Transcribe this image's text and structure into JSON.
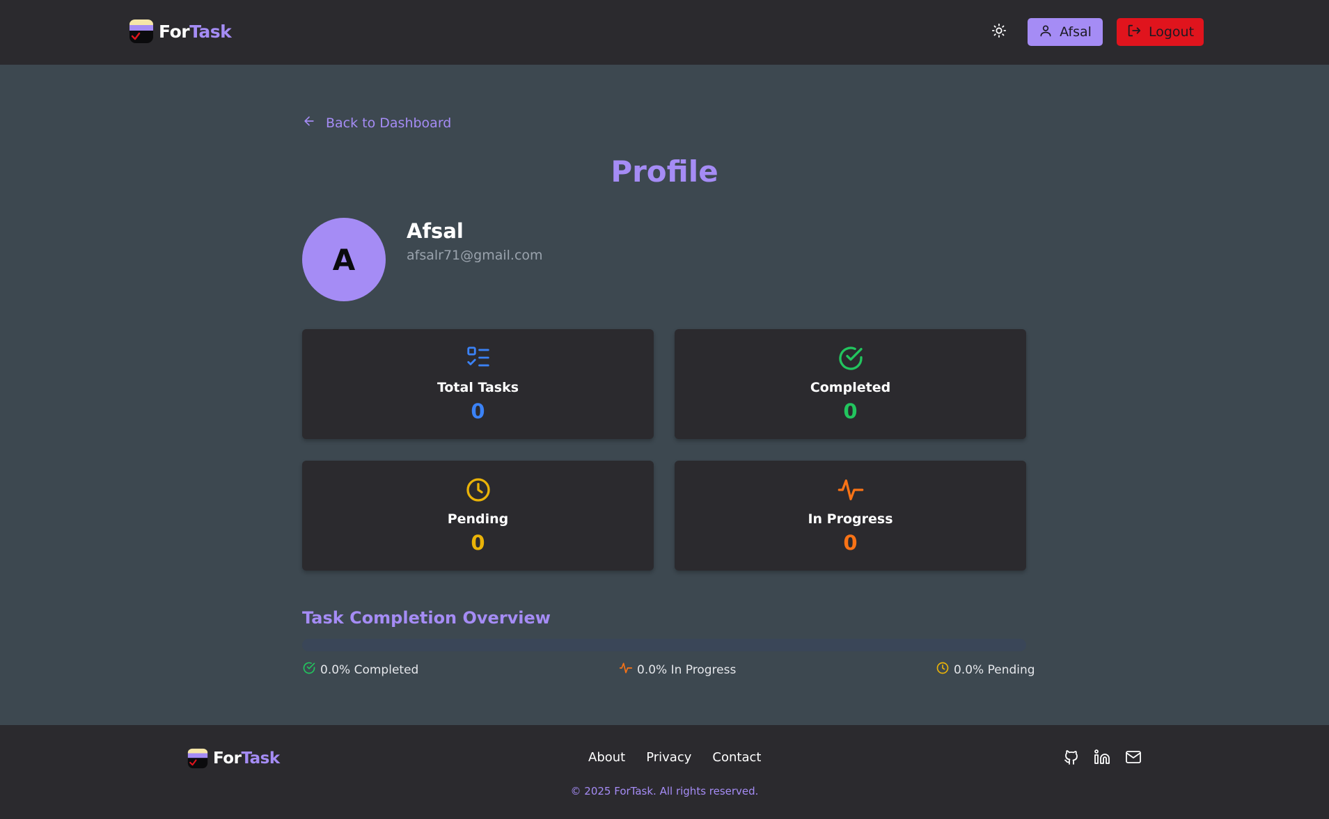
{
  "header": {
    "logo": {
      "part1": "For",
      "part2": "Task"
    },
    "theme_toggle_icon": "sun-icon",
    "user_button_label": "Afsal",
    "logout_label": "Logout"
  },
  "main": {
    "back_link": "Back to Dashboard",
    "title": "Profile",
    "avatar_initial": "A",
    "user_name": "Afsal",
    "user_email": "afsalr71@gmail.com",
    "stats": [
      {
        "label": "Total Tasks",
        "value": "0",
        "icon": "list-check-icon",
        "color": "#3b82f6"
      },
      {
        "label": "Completed",
        "value": "0",
        "icon": "check-circle-icon",
        "color": "#22c55e"
      },
      {
        "label": "Pending",
        "value": "0",
        "icon": "clock-icon",
        "color": "#eab308"
      },
      {
        "label": "In Progress",
        "value": "0",
        "icon": "activity-icon",
        "color": "#f97316"
      }
    ],
    "overview": {
      "title": "Task Completion Overview",
      "completed_fraction": 0.0,
      "legend": [
        {
          "text": "0.0% Completed",
          "icon": "check-circle-icon",
          "color": "#22c55e"
        },
        {
          "text": "0.0% In Progress",
          "icon": "activity-icon",
          "color": "#f97316"
        },
        {
          "text": "0.0% Pending",
          "icon": "clock-icon",
          "color": "#eab308"
        }
      ]
    }
  },
  "footer": {
    "logo": {
      "part1": "For",
      "part2": "Task"
    },
    "nav": [
      "About",
      "Privacy",
      "Contact"
    ],
    "social_icons": [
      "github-icon",
      "linkedin-icon",
      "mail-icon"
    ],
    "copyright": "© 2025 ForTask. All rights reserved."
  },
  "colors": {
    "accent": "#a58cf5",
    "logout": "#e0141d",
    "page_bg": "#3d4850",
    "bar_bg": "#2b2a2e"
  }
}
